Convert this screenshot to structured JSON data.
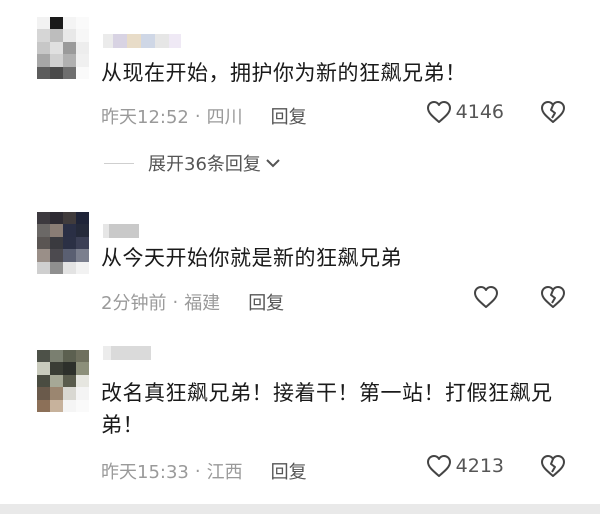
{
  "comments": [
    {
      "text": "从现在开始，拥护你为新的狂飙兄弟！",
      "time": "昨天12:52",
      "location": "四川",
      "reply_label": "回复",
      "likes": "4146",
      "expand_label": "展开36条回复"
    },
    {
      "text": "从今天开始你就是新的狂飙兄弟",
      "time": "2分钟前",
      "location": "福建",
      "reply_label": "回复",
      "likes": ""
    },
    {
      "text": "改名真狂飙兄弟！接着干！第一站！打假狂飙兄弟！",
      "time": "昨天15:33",
      "location": "江西",
      "reply_label": "回复",
      "likes": "4213"
    }
  ],
  "separator": "·",
  "icons": {
    "like": "heart-outline-icon",
    "dislike": "broken-heart-icon",
    "expand": "chevron-down-icon"
  }
}
